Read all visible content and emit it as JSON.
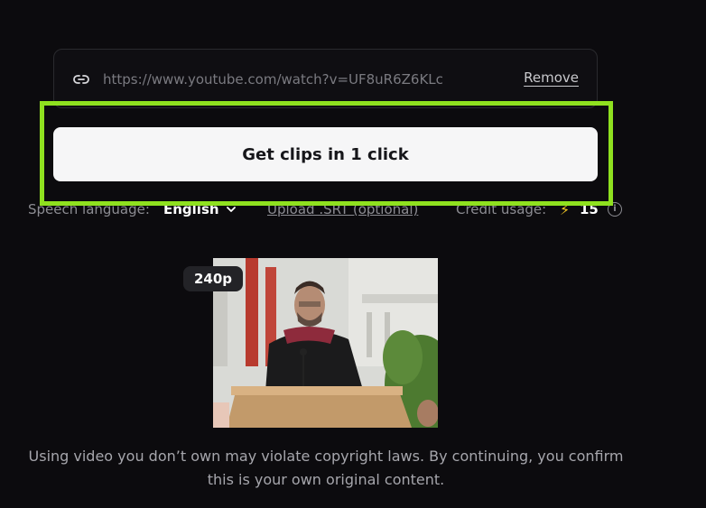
{
  "url_input": {
    "value": "https://www.youtube.com/watch?v=UF8uR6Z6KLc",
    "remove_label": "Remove",
    "icon": "link-icon"
  },
  "primary_button": {
    "label": "Get clips in 1 click"
  },
  "options": {
    "speech_language_label": "Speech language:",
    "speech_language_value": "English",
    "upload_srt_label": "Upload .SRT (optional)",
    "credit_usage_label": "Credit usage:",
    "credit_usage_value": "15",
    "credit_icon": "lightning-icon",
    "info_icon": "info-icon"
  },
  "video_preview": {
    "quality_badge": "240p"
  },
  "disclaimer": {
    "line1": "Using video you don’t own may violate copyright laws. By continuing, you confirm",
    "line2": "this is your own original content."
  },
  "colors": {
    "background": "#0c0b0e",
    "highlight": "#8fe11f",
    "button_bg": "#f6f6f7",
    "credit_bolt": "#f3c623"
  }
}
